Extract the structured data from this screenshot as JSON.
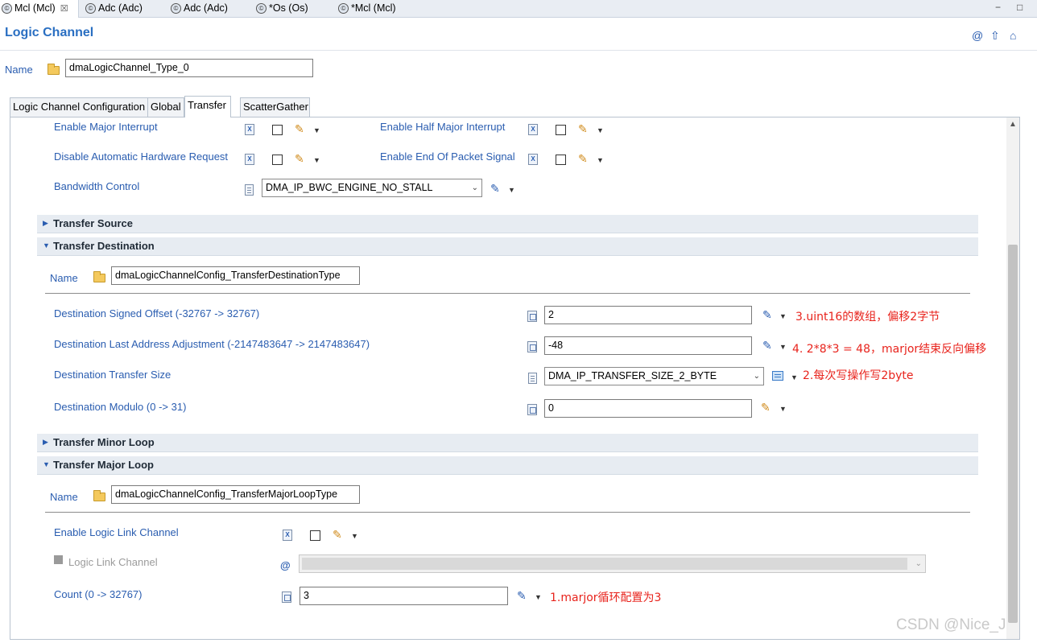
{
  "editor_tabs": [
    {
      "label": "Mcl (Mcl)",
      "close": "☒",
      "active": true
    },
    {
      "label": "Adc (Adc)"
    },
    {
      "label": "Adc (Adc)"
    },
    {
      "label": "*Os (Os)"
    },
    {
      "label": "*Mcl (Mcl)"
    }
  ],
  "window_controls": {
    "minimize": "−",
    "maximize": "□"
  },
  "page": {
    "title": "Logic Channel",
    "icons": [
      "at-icon",
      "up-arrow-icon",
      "home-icon"
    ]
  },
  "name_row": {
    "label": "Name",
    "value": "dmaLogicChannel_Type_0"
  },
  "config_tabs": [
    "Logic Channel Configuration",
    "Global",
    "Transfer",
    "ScatterGather"
  ],
  "active_config_tab": "Transfer",
  "top_fields": {
    "enable_major_interrupt": "Enable Major Interrupt",
    "enable_half_major_interrupt": "Enable Half Major Interrupt",
    "disable_auto_hw_request": "Disable Automatic Hardware Request",
    "enable_end_of_packet": "Enable End Of Packet Signal",
    "bandwidth_control": {
      "label": "Bandwidth Control",
      "value": "DMA_IP_BWC_ENGINE_NO_STALL"
    }
  },
  "sections": {
    "transfer_source": "Transfer Source",
    "transfer_destination": "Transfer Destination",
    "transfer_minor_loop": "Transfer Minor Loop",
    "transfer_major_loop": "Transfer Major Loop"
  },
  "destination": {
    "name_label": "Name",
    "name_value": "dmaLogicChannelConfig_TransferDestinationType",
    "signed_offset": {
      "label": "Destination Signed Offset (-32767 -> 32767)",
      "value": "2",
      "note": "3.uint16的数组，偏移2字节"
    },
    "last_addr_adj": {
      "label": "Destination Last Address Adjustment (-2147483647 -> 2147483647)",
      "value": "-48",
      "note": "4. 2*8*3 = 48，marjor结束反向偏移"
    },
    "transfer_size": {
      "label": "Destination Transfer Size",
      "value": "DMA_IP_TRANSFER_SIZE_2_BYTE",
      "note": "2.每次写操作写2byte"
    },
    "modulo": {
      "label": "Destination Modulo (0 -> 31)",
      "value": "0"
    }
  },
  "major_loop": {
    "name_label": "Name",
    "name_value": "dmaLogicChannelConfig_TransferMajorLoopType",
    "enable_link": "Enable Logic Link Channel",
    "logic_link_channel": "Logic Link Channel",
    "count": {
      "label": "Count (0 -> 32767)",
      "value": "3",
      "note": "1.marjor循环配置为3"
    }
  },
  "watermark": "CSDN @Nice_J",
  "colors": {
    "label_blue": "#2a5db0",
    "title_blue": "#2a6fc2",
    "annotation_red": "#e8231c",
    "section_bg": "#e7ecf2"
  }
}
